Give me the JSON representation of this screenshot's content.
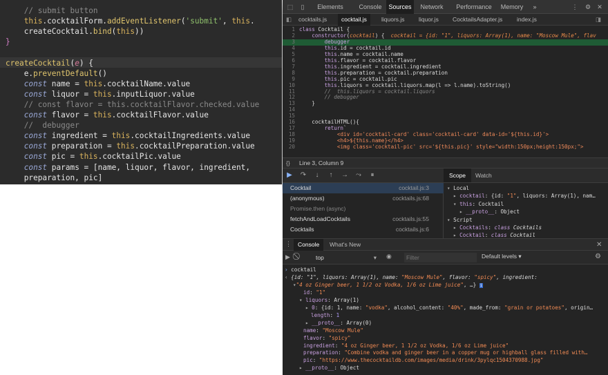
{
  "editor": {
    "lines": [
      [
        {
          "t": "    // submit button",
          "c": "c-cm"
        }
      ],
      [
        {
          "t": "    ",
          "c": "c-wh"
        },
        {
          "t": "this",
          "c": "c-th"
        },
        {
          "t": ".cocktailForm.",
          "c": "c-wh"
        },
        {
          "t": "addEventListener",
          "c": "c-fn"
        },
        {
          "t": "(",
          "c": "c-wh"
        },
        {
          "t": "'submit'",
          "c": "c-st"
        },
        {
          "t": ", ",
          "c": "c-wh"
        },
        {
          "t": "this",
          "c": "c-th"
        },
        {
          "t": ".",
          "c": "c-wh"
        }
      ],
      [
        {
          "t": "    createCocktail.",
          "c": "c-wh"
        },
        {
          "t": "bind",
          "c": "c-fn"
        },
        {
          "t": "(",
          "c": "c-wh"
        },
        {
          "t": "this",
          "c": "c-th"
        },
        {
          "t": "))",
          "c": "c-wh"
        }
      ],
      [
        {
          "t": "}",
          "c": "c-br"
        }
      ],
      [
        {
          "t": "",
          "c": "c-wh"
        }
      ],
      [
        {
          "t": "createCocktail",
          "c": "c-fn"
        },
        {
          "t": "(",
          "c": "c-wh"
        },
        {
          "t": "e",
          "c": "c-pa"
        },
        {
          "t": ") {",
          "c": "c-wh"
        }
      ],
      [
        {
          "t": "    e.",
          "c": "c-wh"
        },
        {
          "t": "preventDefault",
          "c": "c-fn"
        },
        {
          "t": "()",
          "c": "c-wh"
        }
      ],
      [
        {
          "t": "    ",
          "c": "c-wh"
        },
        {
          "t": "const",
          "c": "c-it"
        },
        {
          "t": " name = ",
          "c": "c-wh"
        },
        {
          "t": "this",
          "c": "c-th"
        },
        {
          "t": ".cocktailName.value",
          "c": "c-wh"
        }
      ],
      [
        {
          "t": "    ",
          "c": "c-wh"
        },
        {
          "t": "const",
          "c": "c-it"
        },
        {
          "t": " liquor = ",
          "c": "c-wh"
        },
        {
          "t": "this",
          "c": "c-th"
        },
        {
          "t": ".inputLiquor.value",
          "c": "c-wh"
        }
      ],
      [
        {
          "t": "    // const flavor = this.cocktailFlavor.checked.value",
          "c": "c-cm"
        }
      ],
      [
        {
          "t": "    ",
          "c": "c-wh"
        },
        {
          "t": "const",
          "c": "c-it"
        },
        {
          "t": " flavor = ",
          "c": "c-wh"
        },
        {
          "t": "this",
          "c": "c-th"
        },
        {
          "t": ".cocktailFlavor.value",
          "c": "c-wh"
        }
      ],
      [
        {
          "t": "    //  debugger",
          "c": "c-cm"
        }
      ],
      [
        {
          "t": "    ",
          "c": "c-wh"
        },
        {
          "t": "const",
          "c": "c-it"
        },
        {
          "t": " ingredient = ",
          "c": "c-wh"
        },
        {
          "t": "this",
          "c": "c-th"
        },
        {
          "t": ".cocktailIngredients.value",
          "c": "c-wh"
        }
      ],
      [
        {
          "t": "    ",
          "c": "c-wh"
        },
        {
          "t": "const",
          "c": "c-it"
        },
        {
          "t": " preparation = ",
          "c": "c-wh"
        },
        {
          "t": "this",
          "c": "c-th"
        },
        {
          "t": ".cocktailPreparation.value",
          "c": "c-wh"
        }
      ],
      [
        {
          "t": "    ",
          "c": "c-wh"
        },
        {
          "t": "const",
          "c": "c-it"
        },
        {
          "t": " pic = ",
          "c": "c-wh"
        },
        {
          "t": "this",
          "c": "c-th"
        },
        {
          "t": ".cocktailPic.value",
          "c": "c-wh"
        }
      ],
      [
        {
          "t": "    ",
          "c": "c-wh"
        },
        {
          "t": "const",
          "c": "c-it"
        },
        {
          "t": " params = [name, liquor, flavor, ingredient,",
          "c": "c-wh"
        }
      ],
      [
        {
          "t": "    preparation, pic]",
          "c": "c-wh"
        }
      ]
    ]
  },
  "devtools": {
    "top_tabs": [
      "Elements",
      "Console",
      "Sources",
      "Network",
      "Performance",
      "Memory"
    ],
    "active_top_tab": "Sources",
    "more_tabs": "»",
    "file_tabs": [
      "cocktails.js",
      "cocktail.js",
      "liquors.js",
      "liquor.js",
      "CocktailsAdapter.js",
      "index.js"
    ],
    "active_file_tab": "cocktail.js",
    "code_lines": [
      {
        "no": "1",
        "html": "<span class='ck'>class</span> Cocktail {"
      },
      {
        "no": "2",
        "html": "    <span class='ck'>constructor</span>(<span class='ci'>cocktail</span>) {  <span class='ci'>cocktail = {id: \"1\", liquors: Array(1), name: \"Moscow Mule\", flav</span>"
      },
      {
        "no": "3",
        "html": "        <span class='ck'>debugger</span>",
        "cur": true
      },
      {
        "no": "4",
        "html": "        <span class='ck'>this</span>.id = cocktail.id"
      },
      {
        "no": "5",
        "html": "        <span class='ck'>this</span>.name = cocktail.name"
      },
      {
        "no": "6",
        "html": "        <span class='ck'>this</span>.flavor = cocktail.flavor"
      },
      {
        "no": "7",
        "html": "        <span class='ck'>this</span>.ingredient = cocktail.ingredient"
      },
      {
        "no": "8",
        "html": "        <span class='ck'>this</span>.preparation = cocktail.preparation"
      },
      {
        "no": "9",
        "html": "        <span class='ck'>this</span>.pic = cocktail.pic"
      },
      {
        "no": "10",
        "html": "        <span class='ck'>this</span>.liquors = cocktail.liquors.map(l => l.name).toString()"
      },
      {
        "no": "11",
        "html": "        <span class='cc'>//  this.liquors = cocktail.liquors</span>"
      },
      {
        "no": "12",
        "html": "        <span class='cc'>// debugger</span>"
      },
      {
        "no": "13",
        "html": "    }"
      },
      {
        "no": "14",
        "html": ""
      },
      {
        "no": "15",
        "html": ""
      },
      {
        "no": "16",
        "html": "    cocktailHTML(){"
      },
      {
        "no": "17",
        "html": "        <span class='ck'>return</span>`"
      },
      {
        "no": "18",
        "html": "            <span class='cs'>&lt;div id='cocktail-card' class='cocktail-card' data-id='${this.id}'&gt;</span>"
      },
      {
        "no": "19",
        "html": "            <span class='cs'>&lt;h4&gt;${this.name}&lt;/h4&gt;</span>"
      },
      {
        "no": "20",
        "html": "            <span class='cs'>&lt;img class='cocktail-pic' src='${this.pic}' style=\"width:150px;height:150px;\"&gt;</span>"
      }
    ],
    "cursor_position": "Line 3, Column 9",
    "call_stack": [
      {
        "name": "Cocktail",
        "loc": "cocktail.js:3",
        "sel": true
      },
      {
        "name": "(anonymous)",
        "loc": "cocktails.js:68"
      },
      {
        "name": "Promise.then (async)",
        "loc": "",
        "async": true
      },
      {
        "name": "fetchAndLoadCocktails",
        "loc": "cocktails.js:55"
      },
      {
        "name": "Cocktails",
        "loc": "cocktails.js:6"
      }
    ],
    "scope_tabs": [
      "Scope",
      "Watch"
    ],
    "scope_lines": [
      {
        "ind": 0,
        "html": "<span style='color:#aaa'>▾</span> Local"
      },
      {
        "ind": 1,
        "html": "<span style='color:#aaa'>▸</span> <span class='pk'>cocktail</span>: {id: <span class='ps'>\"1\"</span>, liquors: Array(1), nam…"
      },
      {
        "ind": 1,
        "html": "<span style='color:#aaa'>▾</span> <span class='pk'>this</span>: Cocktail"
      },
      {
        "ind": 2,
        "html": "<span style='color:#aaa'>▸</span> <span class='pk'>__proto__</span>: Object"
      },
      {
        "ind": 0,
        "html": "<span style='color:#aaa'>▾</span> Script"
      },
      {
        "ind": 1,
        "html": "<span style='color:#aaa'>▸</span> <span class='pk'>Cocktails</span>: <span class='pi' style='color:#c8a0e0'>class</span> <span class='pi'>Cocktails</span>"
      },
      {
        "ind": 1,
        "html": "<span style='color:#aaa'>▸</span> <span class='pk'>Cocktail</span>: <span class='pi' style='color:#c8a0e0'>class</span> <span class='pi'>Cocktail</span>"
      }
    ],
    "console_tabs": [
      "Console",
      "What's New"
    ],
    "context": "top",
    "filter_placeholder": "Filter",
    "levels": "Default levels ▾",
    "console_lines": [
      {
        "x": 3,
        "html": "<span style='color:#8ab4f8'>›</span> cocktail"
      },
      {
        "x": 3,
        "html": "<span style='color:#aaa'>‹</span> <span class='pi'>{id: \"1\", liquors: Array(1), name: <span class='ps'>\"Moscow Mule\"</span>, flavor: <span class='ps'>\"spicy\"</span>, ingredient:</span>"
      },
      {
        "x": 15,
        "html": "<span style='color:#aaa'>▾</span><span class='ps pi'>\"4 oz Ginger beer, 1 1/2 oz Vodka, 1/6 oz Lime juice\"</span>, …} <span style='background:#3b6fd0;color:#fff;font-size:6px;padding:0 1px'>i</span>"
      },
      {
        "x": 30,
        "html": "<span class='pk'>id</span>: <span class='ps'>\"1\"</span>"
      },
      {
        "x": 24,
        "html": "<span style='color:#aaa'>▾</span> <span class='pk'>liquors</span>: Array(1)"
      },
      {
        "x": 33,
        "html": "<span style='color:#aaa'>▸</span> <span class='pk'>0</span>: {id: 1, name: <span class='ps'>\"vodka\"</span>, alcohol_content: <span class='ps'>\"40%\"</span>, made_from: <span class='ps'>\"grain or potatoes\"</span>, origin…"
      },
      {
        "x": 41,
        "html": "<span class='pk'>length</span>: <span class='pn'>1</span>"
      },
      {
        "x": 33,
        "html": "<span style='color:#aaa'>▸</span> <span class='pk'>__proto__</span>: Array(0)"
      },
      {
        "x": 30,
        "html": "<span class='pk'>name</span>: <span class='ps'>\"Moscow Mule\"</span>"
      },
      {
        "x": 30,
        "html": "<span class='pk'>flavor</span>: <span class='ps'>\"spicy\"</span>"
      },
      {
        "x": 30,
        "html": "<span class='pk'>ingredient</span>: <span class='ps'>\"4 oz Ginger beer, 1 1/2 oz Vodka, 1/6 oz Lime juice\"</span>"
      },
      {
        "x": 30,
        "html": "<span class='pk'>preparation</span>: <span class='ps'>\"Combine vodka and ginger beer in a copper mug or highball glass filled with…</span>"
      },
      {
        "x": 30,
        "html": "<span class='pk'>pic</span>: <span class='ps'>\"https://www.thecocktaildb.com/images/media/drink/3pylqc1504370988.jpg\"</span>"
      },
      {
        "x": 24,
        "html": "<span style='color:#aaa'>▸</span> <span class='pk'>__proto__</span>: Object"
      }
    ]
  }
}
